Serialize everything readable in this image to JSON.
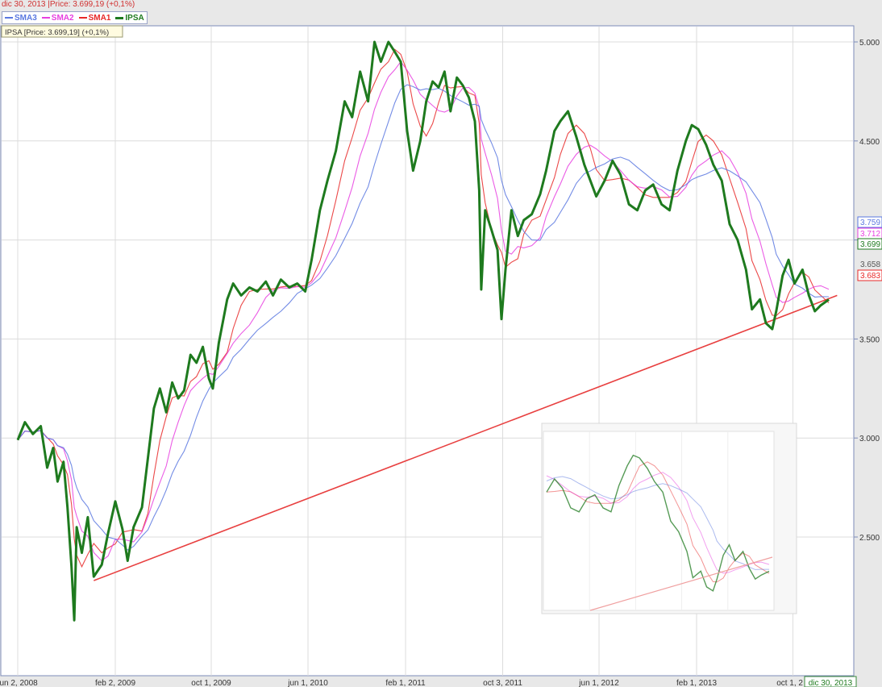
{
  "header": {
    "status_text": "dic 30, 2013 |Price: 3.699,19 (+0,1%)"
  },
  "legend": [
    {
      "name": "SMA3",
      "color": "#5a78e0"
    },
    {
      "name": "SMA2",
      "color": "#e840e0"
    },
    {
      "name": "SMA1",
      "color": "#e82828"
    },
    {
      "name": "IPSA",
      "color": "#1e7a1e"
    }
  ],
  "price_box": "IPSA [Price: 3.699,19] (+0,1%)",
  "chart_data": {
    "type": "line",
    "ylim": [
      2000,
      5100
    ],
    "yticks": [
      {
        "value": 2500,
        "label": "2.500"
      },
      {
        "value": 3000,
        "label": "3.000"
      },
      {
        "value": 3500,
        "label": "3.500"
      },
      {
        "value": 4000,
        "label": "4.000"
      },
      {
        "value": 4500,
        "label": "4.500"
      },
      {
        "value": 5000,
        "label": "5.000"
      }
    ],
    "xticks": [
      {
        "date": "2008-06-02",
        "label": "jun 2, 2008"
      },
      {
        "date": "2009-02-02",
        "label": "feb 2, 2009"
      },
      {
        "date": "2009-10-01",
        "label": "oct 1, 2009"
      },
      {
        "date": "2010-06-01",
        "label": "jun 1, 2010"
      },
      {
        "date": "2011-02-01",
        "label": "feb 1, 2011"
      },
      {
        "date": "2011-10-03",
        "label": "oct 3, 2011"
      },
      {
        "date": "2012-06-01",
        "label": "jun 1, 2012"
      },
      {
        "date": "2013-02-01",
        "label": "feb 1, 2013"
      },
      {
        "date": "2013-10-01",
        "label": "oct 1, 2"
      }
    ],
    "last_date_label": "dic 30, 2013",
    "ipsa": {
      "name": "IPSA",
      "color": "#1e7a1e",
      "points": [
        [
          "2008-06-02",
          2990
        ],
        [
          "2008-06-20",
          3080
        ],
        [
          "2008-07-10",
          3020
        ],
        [
          "2008-07-30",
          3060
        ],
        [
          "2008-08-15",
          2850
        ],
        [
          "2008-08-30",
          2950
        ],
        [
          "2008-09-10",
          2780
        ],
        [
          "2008-09-25",
          2880
        ],
        [
          "2008-10-05",
          2650
        ],
        [
          "2008-10-15",
          2350
        ],
        [
          "2008-10-22",
          2080
        ],
        [
          "2008-10-28",
          2550
        ],
        [
          "2008-11-10",
          2420
        ],
        [
          "2008-11-25",
          2600
        ],
        [
          "2008-12-10",
          2300
        ],
        [
          "2008-12-30",
          2360
        ],
        [
          "2009-01-15",
          2520
        ],
        [
          "2009-02-02",
          2680
        ],
        [
          "2009-02-20",
          2540
        ],
        [
          "2009-03-05",
          2380
        ],
        [
          "2009-03-20",
          2550
        ],
        [
          "2009-04-10",
          2650
        ],
        [
          "2009-04-25",
          2900
        ],
        [
          "2009-05-10",
          3150
        ],
        [
          "2009-05-25",
          3250
        ],
        [
          "2009-06-10",
          3130
        ],
        [
          "2009-06-25",
          3280
        ],
        [
          "2009-07-10",
          3200
        ],
        [
          "2009-07-25",
          3240
        ],
        [
          "2009-08-10",
          3420
        ],
        [
          "2009-08-25",
          3380
        ],
        [
          "2009-09-10",
          3460
        ],
        [
          "2009-09-25",
          3300
        ],
        [
          "2009-10-05",
          3250
        ],
        [
          "2009-10-20",
          3480
        ],
        [
          "2009-11-10",
          3700
        ],
        [
          "2009-11-25",
          3780
        ],
        [
          "2009-12-15",
          3720
        ],
        [
          "2010-01-05",
          3760
        ],
        [
          "2010-01-25",
          3740
        ],
        [
          "2010-02-15",
          3790
        ],
        [
          "2010-03-05",
          3720
        ],
        [
          "2010-03-25",
          3800
        ],
        [
          "2010-04-15",
          3760
        ],
        [
          "2010-05-05",
          3780
        ],
        [
          "2010-05-25",
          3740
        ],
        [
          "2010-06-10",
          3900
        ],
        [
          "2010-07-01",
          4150
        ],
        [
          "2010-07-20",
          4300
        ],
        [
          "2010-08-10",
          4450
        ],
        [
          "2010-09-01",
          4700
        ],
        [
          "2010-09-20",
          4620
        ],
        [
          "2010-10-10",
          4850
        ],
        [
          "2010-10-30",
          4700
        ],
        [
          "2010-11-15",
          5000
        ],
        [
          "2010-12-01",
          4900
        ],
        [
          "2010-12-20",
          5000
        ],
        [
          "2011-01-05",
          4950
        ],
        [
          "2011-01-20",
          4900
        ],
        [
          "2011-02-05",
          4550
        ],
        [
          "2011-02-20",
          4350
        ],
        [
          "2011-03-10",
          4500
        ],
        [
          "2011-03-25",
          4700
        ],
        [
          "2011-04-10",
          4800
        ],
        [
          "2011-04-25",
          4770
        ],
        [
          "2011-05-10",
          4850
        ],
        [
          "2011-05-25",
          4650
        ],
        [
          "2011-06-10",
          4820
        ],
        [
          "2011-06-25",
          4780
        ],
        [
          "2011-07-10",
          4720
        ],
        [
          "2011-07-25",
          4600
        ],
        [
          "2011-08-05",
          4250
        ],
        [
          "2011-08-10",
          3750
        ],
        [
          "2011-08-20",
          4150
        ],
        [
          "2011-09-05",
          4050
        ],
        [
          "2011-09-20",
          3950
        ],
        [
          "2011-09-30",
          3600
        ],
        [
          "2011-10-10",
          3850
        ],
        [
          "2011-10-25",
          4150
        ],
        [
          "2011-11-10",
          4020
        ],
        [
          "2011-11-25",
          4100
        ],
        [
          "2011-12-15",
          4130
        ],
        [
          "2012-01-05",
          4230
        ],
        [
          "2012-01-20",
          4350
        ],
        [
          "2012-02-10",
          4550
        ],
        [
          "2012-02-25",
          4600
        ],
        [
          "2012-03-15",
          4650
        ],
        [
          "2012-04-05",
          4520
        ],
        [
          "2012-04-25",
          4380
        ],
        [
          "2012-05-10",
          4300
        ],
        [
          "2012-05-25",
          4220
        ],
        [
          "2012-06-15",
          4300
        ],
        [
          "2012-07-05",
          4400
        ],
        [
          "2012-07-25",
          4330
        ],
        [
          "2012-08-15",
          4180
        ],
        [
          "2012-09-05",
          4150
        ],
        [
          "2012-09-25",
          4250
        ],
        [
          "2012-10-15",
          4280
        ],
        [
          "2012-11-05",
          4180
        ],
        [
          "2012-11-25",
          4150
        ],
        [
          "2012-12-15",
          4350
        ],
        [
          "2013-01-05",
          4500
        ],
        [
          "2013-01-20",
          4580
        ],
        [
          "2013-02-05",
          4560
        ],
        [
          "2013-02-25",
          4480
        ],
        [
          "2013-03-15",
          4380
        ],
        [
          "2013-04-05",
          4300
        ],
        [
          "2013-04-25",
          4080
        ],
        [
          "2013-05-15",
          4000
        ],
        [
          "2013-06-05",
          3850
        ],
        [
          "2013-06-20",
          3650
        ],
        [
          "2013-07-10",
          3700
        ],
        [
          "2013-07-25",
          3580
        ],
        [
          "2013-08-10",
          3550
        ],
        [
          "2013-08-20",
          3640
        ],
        [
          "2013-09-05",
          3820
        ],
        [
          "2013-09-20",
          3900
        ],
        [
          "2013-10-05",
          3780
        ],
        [
          "2013-10-25",
          3850
        ],
        [
          "2013-11-10",
          3720
        ],
        [
          "2013-11-25",
          3640
        ],
        [
          "2013-12-10",
          3670
        ],
        [
          "2013-12-30",
          3699
        ]
      ]
    },
    "sma": [
      {
        "name": "SMA1",
        "color": "#e82828",
        "window": 4
      },
      {
        "name": "SMA2",
        "color": "#e840e0",
        "window": 7
      },
      {
        "name": "SMA3",
        "color": "#5a78e0",
        "window": 11
      }
    ],
    "trendline": {
      "color": "#e84040",
      "from": [
        "2008-12-10",
        2280
      ],
      "to": [
        "2014-01-20",
        3720
      ]
    },
    "last_values": [
      {
        "label": "3.759",
        "color": "#5a78e0",
        "value": 3759
      },
      {
        "label": "3.712",
        "color": "#e840e0",
        "value": 3712
      },
      {
        "label": "3.699",
        "color": "#1e7a1e",
        "value": 3699
      },
      {
        "label": "3.658",
        "color": "#555555",
        "value": 3658
      },
      {
        "label": "3.683",
        "color": "#e82828",
        "value": 3683
      }
    ]
  }
}
